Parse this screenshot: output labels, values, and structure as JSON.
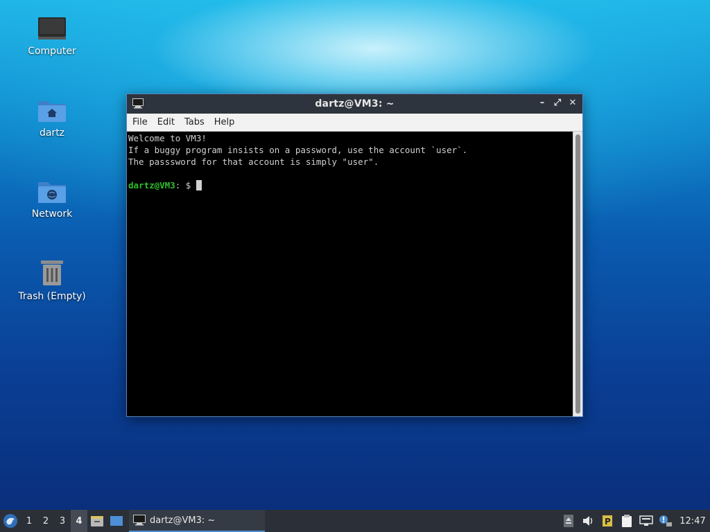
{
  "desktop": {
    "icons": [
      {
        "label": "Computer",
        "icon": "computer-icon"
      },
      {
        "label": "dartz",
        "icon": "home-folder-icon"
      },
      {
        "label": "Network",
        "icon": "network-folder-icon"
      },
      {
        "label": "Trash (Empty)",
        "icon": "trash-icon"
      }
    ]
  },
  "window": {
    "title": "dartz@VM3: ~",
    "controls": {
      "minimize": "–",
      "maximize": "⤢",
      "close": "✕"
    },
    "menu": [
      "File",
      "Edit",
      "Tabs",
      "Help"
    ],
    "terminal": {
      "lines": [
        "Welcome to VM3!",
        "If a buggy program insists on a password, use the account `user`.",
        "The passsword for that account is simply \"user\"."
      ],
      "prompt_user": "dartz@VM3",
      "prompt_rest": ": $ "
    }
  },
  "taskbar": {
    "workspaces": [
      "1",
      "2",
      "3",
      "4"
    ],
    "active_workspace": "4",
    "task_label": "dartz@VM3: ~",
    "clock": "12:47"
  },
  "colors": {
    "prompt_green": "#2fbf2f",
    "taskbar_bg": "#2b3038",
    "titlebar_bg": "#2e343d",
    "accent": "#4d8fd6"
  }
}
